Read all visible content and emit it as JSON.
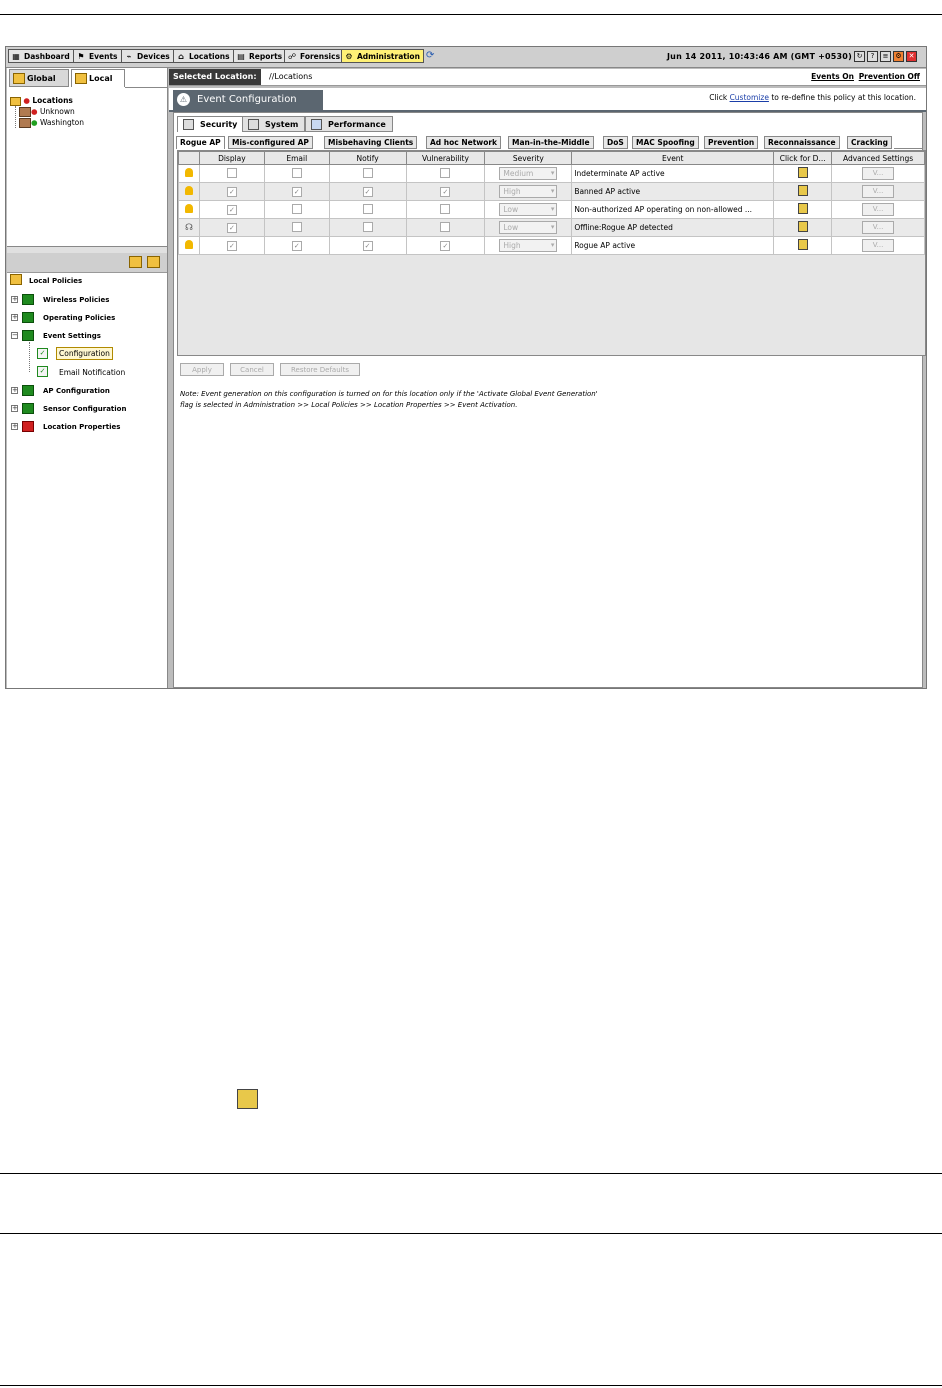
{
  "nav": {
    "buttons": [
      {
        "label": "Dashboard",
        "icon": "dashboard-icon"
      },
      {
        "label": "Events",
        "icon": "events-icon"
      },
      {
        "label": "Devices",
        "icon": "devices-icon"
      },
      {
        "label": "Locations",
        "icon": "locations-icon"
      },
      {
        "label": "Reports",
        "icon": "reports-icon"
      },
      {
        "label": "Forensics",
        "icon": "forensics-icon"
      },
      {
        "label": "Administration",
        "icon": "administration-icon",
        "active": true
      }
    ],
    "datetime": "Jun 14 2011, 10:43:46 AM (GMT +0530)"
  },
  "left": {
    "tabs": {
      "global": "Global",
      "local": "Local"
    },
    "tree": {
      "root": "Locations",
      "child1": "Unknown",
      "child2": "Washington"
    },
    "policies": {
      "title": "Local Policies",
      "wireless": "Wireless Policies",
      "operating": "Operating Policies",
      "event_settings": "Event Settings",
      "configuration": "Configuration",
      "email_notification": "Email Notification",
      "ap_configuration": "AP Configuration",
      "sensor_configuration": "Sensor Configuration",
      "location_properties": "Location Properties"
    }
  },
  "right": {
    "selected_location_label": "Selected Location:",
    "selected_location_value": "//Locations",
    "events_on": "Events On",
    "prevention_off": "Prevention Off",
    "title": "Event Configuration",
    "customize_pre": "Click ",
    "customize_link": "Customize",
    "customize_post": " to re-define this policy at this location.",
    "main_tabs": {
      "security": "Security",
      "system": "System",
      "performance": "Performance"
    },
    "sub_tabs": [
      "Rogue AP",
      "Mis-configured AP",
      "Misbehaving Clients",
      "Ad hoc Network",
      "Man-in-the-Middle",
      "DoS",
      "MAC Spoofing",
      "Prevention",
      "Reconnaissance",
      "Cracking"
    ],
    "columns": {
      "display": "Display",
      "email": "Email",
      "notify": "Notify",
      "vulnerability": "Vulnerability",
      "severity": "Severity",
      "event": "Event",
      "click": "Click for D...",
      "advanced": "Advanced Settings"
    },
    "rows": [
      {
        "severity": "Medium",
        "event": "Indeterminate AP active",
        "v": "V..."
      },
      {
        "severity": "High",
        "event": "Banned AP active",
        "v": "V..."
      },
      {
        "severity": "Low",
        "event": "Non-authorized AP operating on non-allowed ...",
        "v": "V..."
      },
      {
        "severity": "Low",
        "event": "Offline:Rogue AP detected",
        "v": "V..."
      },
      {
        "severity": "High",
        "event": "Rogue AP active",
        "v": "V..."
      }
    ],
    "buttons": {
      "apply": "Apply",
      "cancel": "Cancel",
      "restore": "Restore Defaults"
    },
    "note_line1": "Note: Event generation on this configuration is turned on for this location only if the 'Activate Global Event Generation'",
    "note_line2": "flag is selected in Administration >> Local Policies >> Location Properties >> Event Activation."
  }
}
